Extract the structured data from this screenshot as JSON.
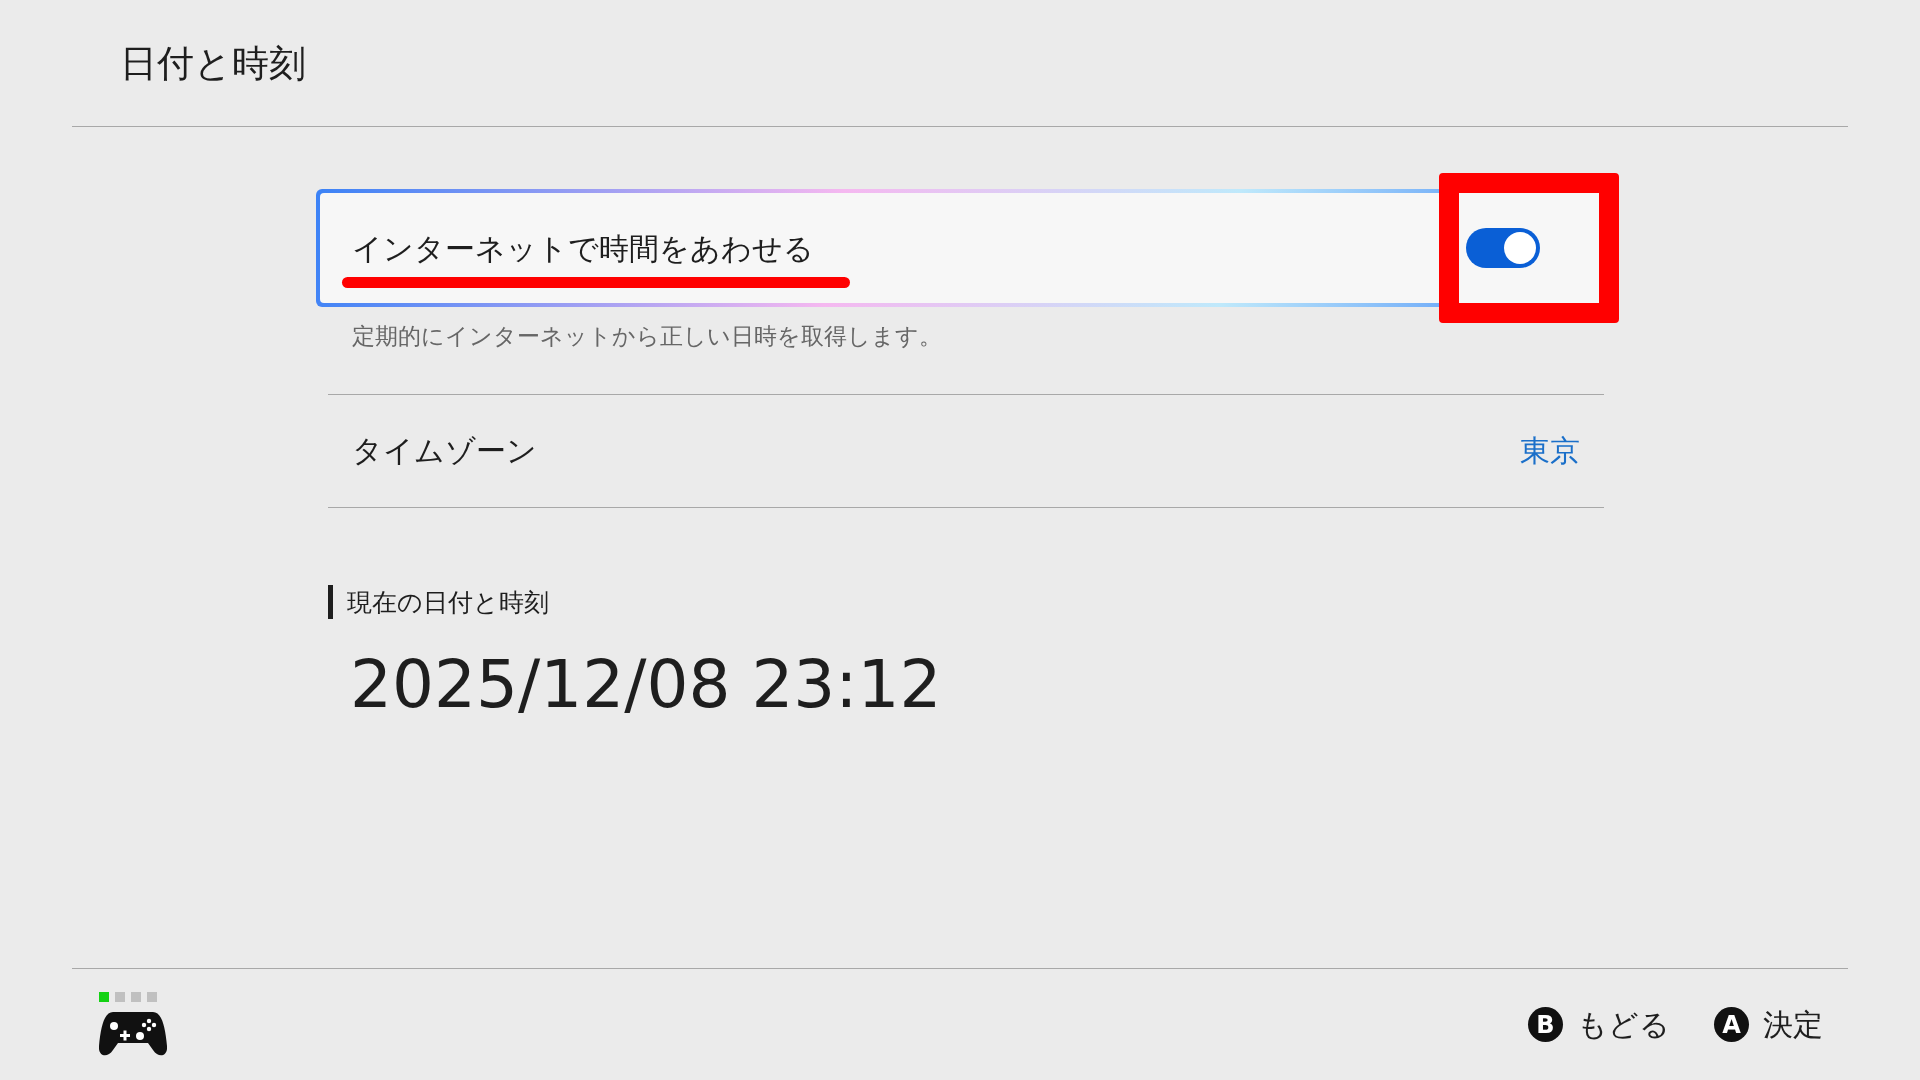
{
  "header": {
    "title": "日付と時刻"
  },
  "sync_setting": {
    "label": "インターネットで時間をあわせる",
    "on": true,
    "selected": true,
    "description": "定期的にインターネットから正しい日時を取得します。"
  },
  "timezone": {
    "label": "タイムゾーン",
    "value": "東京"
  },
  "current": {
    "heading": "現在の日付と時刻",
    "datetime": "2025/12/08 23:12"
  },
  "footer": {
    "player_lights": [
      {
        "on": true
      },
      {
        "on": false
      },
      {
        "on": false
      },
      {
        "on": false
      }
    ],
    "buttons": [
      {
        "key": "B",
        "label": "もどる"
      },
      {
        "key": "A",
        "label": "決定"
      }
    ]
  }
}
